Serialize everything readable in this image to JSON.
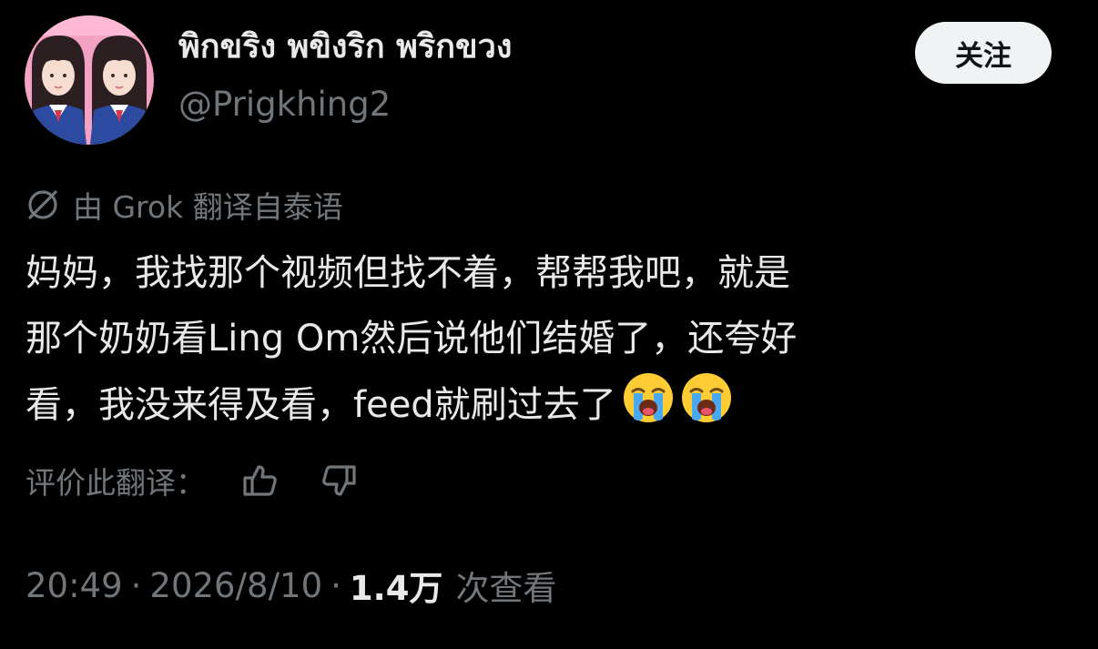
{
  "author": {
    "display_name": "พิกขริง พขิงริก พริกขวง",
    "handle": "@Prigkhing2",
    "avatar": "avatar-photo"
  },
  "follow_button": {
    "label": "关注"
  },
  "translation_notice": {
    "icon": "translate-off-icon",
    "text": "由 Grok 翻译自泰语"
  },
  "tweet": {
    "lines": [
      "妈妈，我找那个视频但找不着，帮帮我吧，就是",
      "那个奶奶看Ling Om然后说他们结婚了，还夸好",
      "看，我没来得及看，feed就刷过去了"
    ],
    "emojis": [
      "loudly-crying-face-emoji",
      "loudly-crying-face-emoji"
    ]
  },
  "rate_translation": {
    "label": "评价此翻译：",
    "thumbs_up_icon": "thumbs-up-icon",
    "thumbs_down_icon": "thumbs-down-icon"
  },
  "meta": {
    "time": "20:49",
    "separator": "·",
    "date": "2026/8/10",
    "views_count": "1.4万",
    "views_label": "次查看"
  },
  "colors": {
    "background": "#000000",
    "primary_text": "#e7e9ea",
    "secondary_text": "#71767b",
    "follow_button_bg": "#eff3f4",
    "follow_button_text": "#0f1419"
  }
}
